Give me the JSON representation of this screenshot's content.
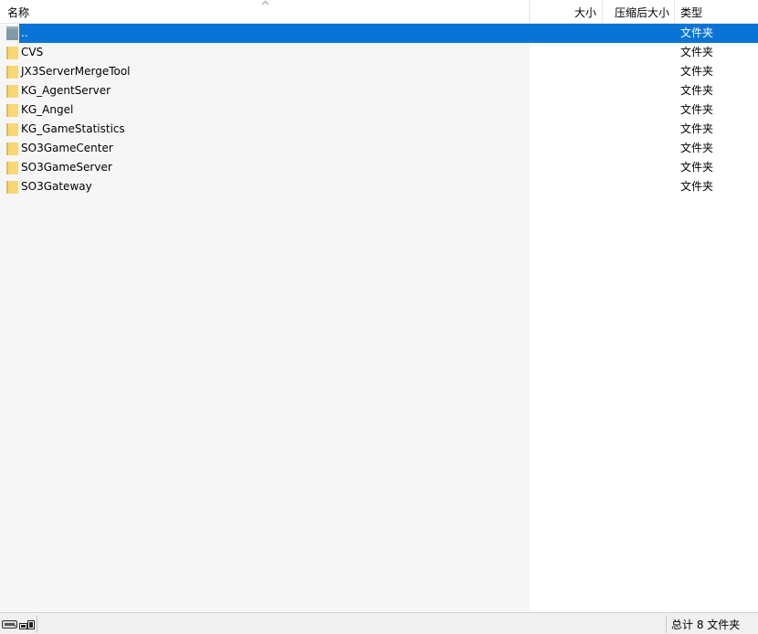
{
  "columns": {
    "name": "名称",
    "size": "大小",
    "packed": "压缩后大小",
    "type": "类型"
  },
  "sort": {
    "column": "name",
    "direction": "ascending"
  },
  "rows": [
    {
      "name": "..",
      "type": "文件夹",
      "icon": "parent-folder-icon",
      "selected": true
    },
    {
      "name": "CVS",
      "type": "文件夹",
      "icon": "folder-icon",
      "selected": false
    },
    {
      "name": "JX3ServerMergeTool",
      "type": "文件夹",
      "icon": "folder-icon",
      "selected": false
    },
    {
      "name": "KG_AgentServer",
      "type": "文件夹",
      "icon": "folder-icon",
      "selected": false
    },
    {
      "name": "KG_Angel",
      "type": "文件夹",
      "icon": "folder-icon",
      "selected": false
    },
    {
      "name": "KG_GameStatistics",
      "type": "文件夹",
      "icon": "folder-icon",
      "selected": false
    },
    {
      "name": "SO3GameCenter",
      "type": "文件夹",
      "icon": "folder-icon",
      "selected": false
    },
    {
      "name": "SO3GameServer",
      "type": "文件夹",
      "icon": "folder-icon",
      "selected": false
    },
    {
      "name": "SO3Gateway",
      "type": "文件夹",
      "icon": "folder-icon",
      "selected": false
    }
  ],
  "statusbar": {
    "summary": "总计 8 文件夹",
    "icons": [
      "drive-icon",
      "network-icon"
    ]
  },
  "colors": {
    "selection": "#0a74d6",
    "folder": "#f8d775",
    "name_column_bg": "#f6f6f6"
  }
}
